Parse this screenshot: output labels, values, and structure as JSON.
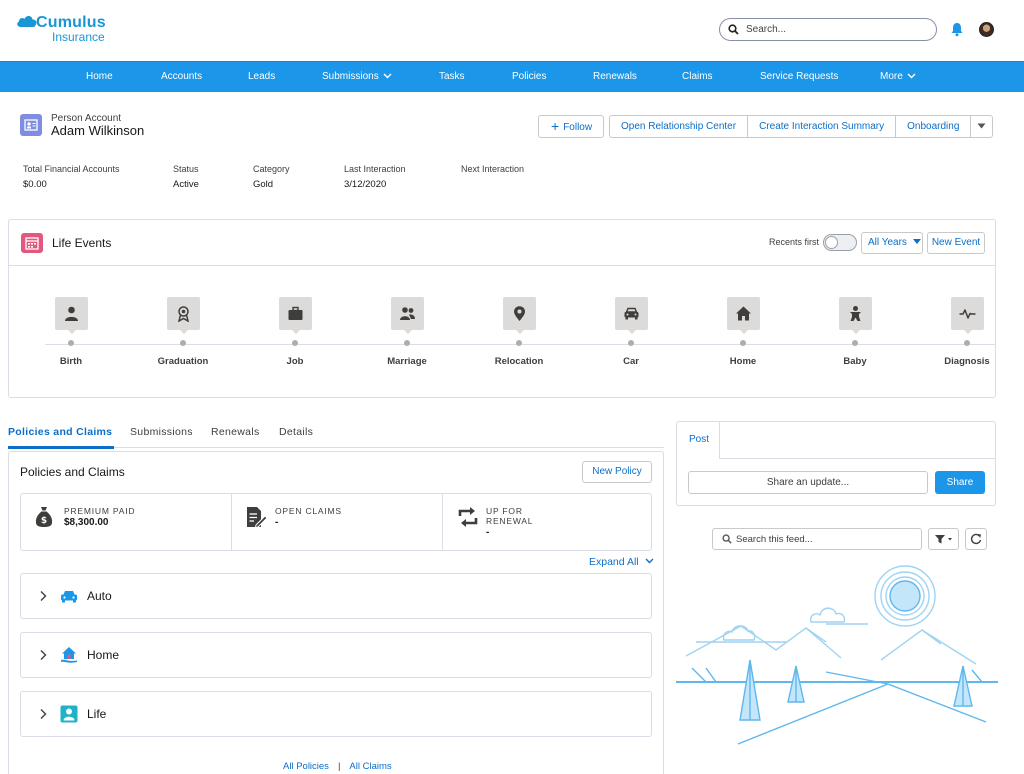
{
  "brand": {
    "name": "Cumulus",
    "sub": "Insurance",
    "color": "#1b96d4"
  },
  "header": {
    "search_placeholder": "Search..."
  },
  "nav": {
    "items": [
      {
        "label": "Home"
      },
      {
        "label": "Accounts"
      },
      {
        "label": "Leads"
      },
      {
        "label": "Submissions",
        "dropdown": true
      },
      {
        "label": "Tasks"
      },
      {
        "label": "Policies"
      },
      {
        "label": "Renewals"
      },
      {
        "label": "Claims"
      },
      {
        "label": "Service Requests"
      },
      {
        "label": "More",
        "dropdown": true
      }
    ],
    "color": "#1b96e8"
  },
  "record": {
    "type": "Person Account",
    "name": "Adam Wilkinson",
    "follow_label": "Follow",
    "actions": [
      "Open Relationship Center",
      "Create Interaction Summary",
      "Onboarding"
    ],
    "fields": [
      {
        "label": "Total Financial Accounts",
        "value": "$0.00"
      },
      {
        "label": "Status",
        "value": "Active"
      },
      {
        "label": "Category",
        "value": "Gold"
      },
      {
        "label": "Last Interaction",
        "value": "3/12/2020"
      },
      {
        "label": "Next Interaction",
        "value": ""
      }
    ]
  },
  "life_events": {
    "title": "Life Events",
    "recents_label": "Recents first",
    "recents_on": false,
    "filter_label": "All Years",
    "new_event_label": "New Event",
    "events": [
      {
        "label": "Birth",
        "icon": "person-icon"
      },
      {
        "label": "Graduation",
        "icon": "award-icon"
      },
      {
        "label": "Job",
        "icon": "briefcase-icon"
      },
      {
        "label": "Marriage",
        "icon": "people-icon"
      },
      {
        "label": "Relocation",
        "icon": "location-pin-icon"
      },
      {
        "label": "Car",
        "icon": "car-icon"
      },
      {
        "label": "Home",
        "icon": "house-icon"
      },
      {
        "label": "Baby",
        "icon": "baby-icon"
      },
      {
        "label": "Diagnosis",
        "icon": "pulse-icon"
      }
    ]
  },
  "tabs": {
    "items": [
      "Policies and Claims",
      "Submissions",
      "Renewals",
      "Details"
    ],
    "active": "Policies and Claims"
  },
  "policies": {
    "title": "Policies and Claims",
    "new_policy_label": "New Policy",
    "stats": [
      {
        "label": "Premium Paid",
        "value": "$8,300.00",
        "icon": "money-bag-icon"
      },
      {
        "label": "Open Claims",
        "value": "-",
        "icon": "claim-document-icon"
      },
      {
        "label": "Up for Renewal",
        "value": "-",
        "icon": "renew-arrows-icon"
      }
    ],
    "expand_all_label": "Expand All",
    "groups": [
      {
        "label": "Auto",
        "icon": "car-icon",
        "color": "#1b96e8"
      },
      {
        "label": "Home",
        "icon": "house-icon",
        "color": "#1b96e8"
      },
      {
        "label": "Life",
        "icon": "person-icon",
        "color": "#1fb3c7"
      }
    ],
    "links": {
      "all_policies": "All Policies",
      "separator": "|",
      "all_claims": "All Claims"
    }
  },
  "feed": {
    "post_tab": "Post",
    "share_placeholder": "Share an update...",
    "share_label": "Share",
    "search_placeholder": "Search this feed..."
  }
}
